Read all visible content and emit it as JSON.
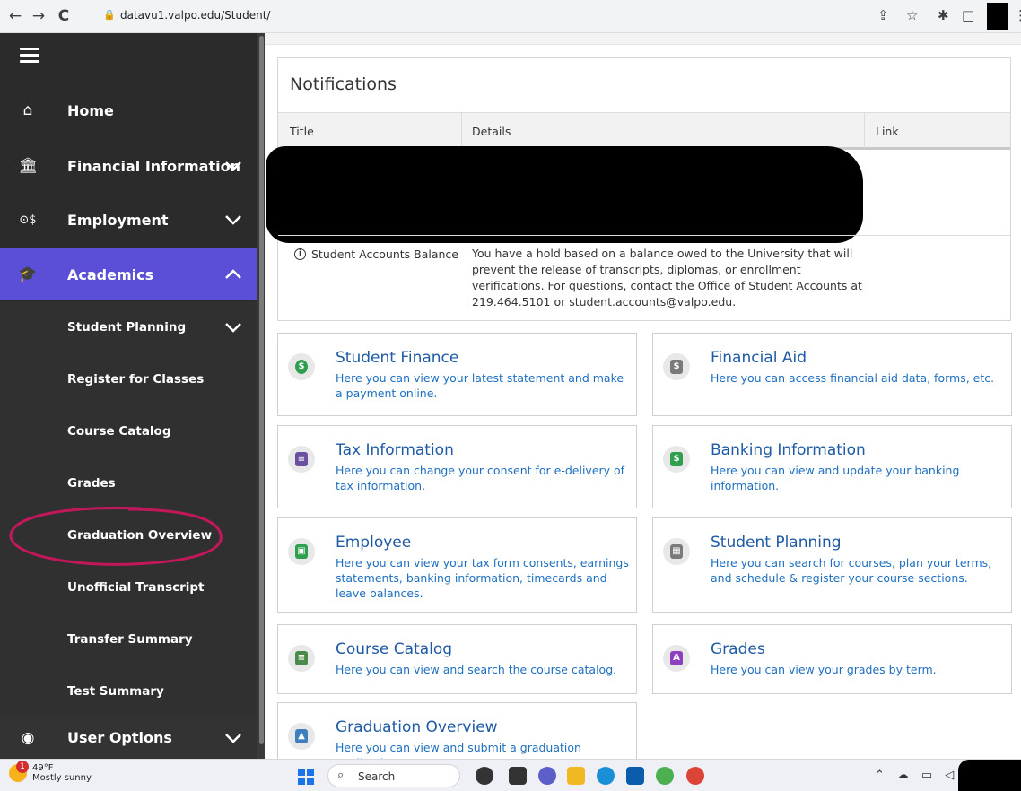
{
  "browser": {
    "url": "datavu1.valpo.edu/Student/",
    "back": "←",
    "forward": "→",
    "reload": "C"
  },
  "sidebar": {
    "items": [
      {
        "label": "Home",
        "icon": "home-icon"
      },
      {
        "label": "Financial Information",
        "icon": "bank-icon"
      },
      {
        "label": "Employment",
        "icon": "employment-icon"
      },
      {
        "label": "Academics",
        "icon": "graduation-cap-icon"
      }
    ],
    "sub_items": [
      {
        "label": "Student Planning"
      },
      {
        "label": "Register for Classes"
      },
      {
        "label": "Course Catalog"
      },
      {
        "label": "Grades"
      },
      {
        "label": "Graduation Overview"
      },
      {
        "label": "Unofficial Transcript"
      },
      {
        "label": "Transfer Summary"
      },
      {
        "label": "Test Summary"
      }
    ],
    "user_options": "User Options",
    "accent": "#5a4fd6"
  },
  "notifications": {
    "title": "Notifications",
    "columns": [
      "Title",
      "Details",
      "Link"
    ],
    "row": {
      "title": "Student Accounts Balance",
      "details": "You have a hold based on a balance owed to the University that will prevent the release of transcripts, diplomas, or enrollment verifications. For questions, contact the Office of Student Accounts at 219.464.5101 or student.accounts@valpo.edu."
    }
  },
  "cards": [
    {
      "title": "Student Finance",
      "desc": "Here you can view your latest statement and make a payment online."
    },
    {
      "title": "Financial Aid",
      "desc": "Here you can access financial aid data, forms, etc."
    },
    {
      "title": "Tax Information",
      "desc": "Here you can change your consent for e-delivery of tax information."
    },
    {
      "title": "Banking Information",
      "desc": "Here you can view and update your banking information."
    },
    {
      "title": "Employee",
      "desc": "Here you can view your tax form consents, earnings statements, banking information, timecards and leave balances."
    },
    {
      "title": "Student Planning",
      "desc": "Here you can search for courses, plan your terms, and schedule & register your course sections."
    },
    {
      "title": "Course Catalog",
      "desc": "Here you can view and search the course catalog."
    },
    {
      "title": "Grades",
      "desc": "Here you can view your grades by term."
    },
    {
      "title": "Graduation Overview",
      "desc": "Here you can view and submit a graduation application."
    }
  ],
  "taskbar": {
    "temp": "49°F",
    "weather": "Mostly sunny",
    "badge": "1",
    "search": "Search"
  }
}
